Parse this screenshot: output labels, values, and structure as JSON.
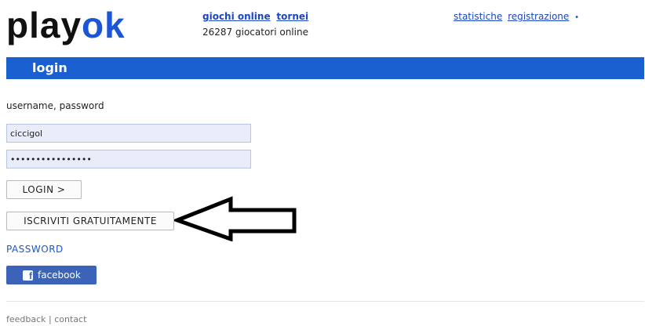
{
  "header": {
    "logo_left": "play",
    "logo_right": "ok",
    "nav_games": "giochi online",
    "nav_tournaments": "tornei",
    "players_online": "26287 giocatori online",
    "nav_stats": "statistiche",
    "nav_register": "registrazione",
    "nav_more_icon": "dot-icon"
  },
  "login": {
    "bar_title": "login",
    "fields_label": "username, password",
    "username_value": "ciccigol",
    "password_value": "••••••••••••••••",
    "login_button": "LOGIN >",
    "signup_button": "ISCRIVITI GRATUITAMENTE",
    "password_link": "PASSWORD",
    "facebook_icon": "f",
    "facebook_label": "facebook"
  },
  "footer": {
    "feedback": "feedback",
    "separator": "|",
    "contact": "contact"
  },
  "colors": {
    "accent_blue": "#1a5fd0",
    "link_blue": "#1a46c4",
    "facebook_blue": "#3b64b8",
    "input_bg": "#e8edf9"
  }
}
